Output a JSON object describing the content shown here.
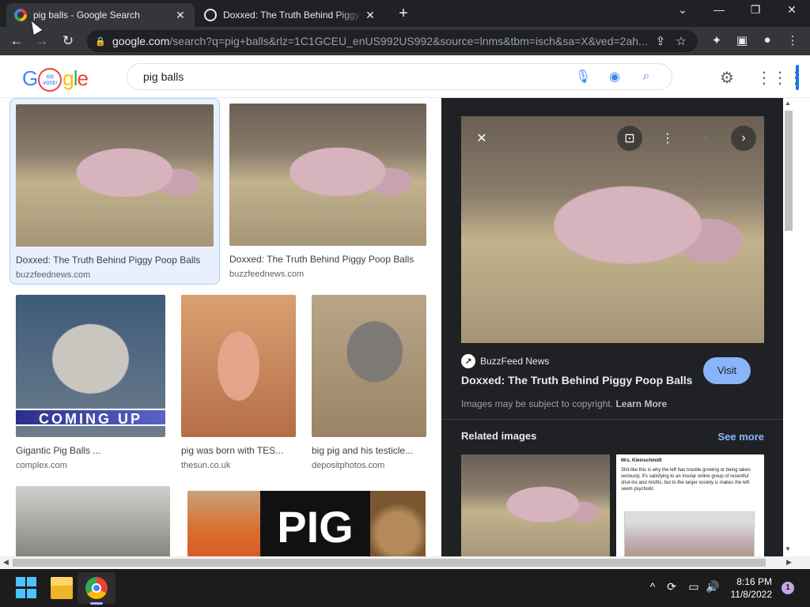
{
  "browser": {
    "tabs": [
      {
        "title": "pig balls - Google Search",
        "active": true
      },
      {
        "title": "Doxxed: The Truth Behind Piggy Poop Balls",
        "active": false
      }
    ],
    "new_tab": "+",
    "url_host": "google.com",
    "url_rest": "/search?q=pig+balls&rlz=1C1GCEU_enUS992US992&source=lnms&tbm=isch&sa=X&ved=2ah..."
  },
  "google": {
    "logo_letters": [
      "G",
      "o",
      "g",
      "l",
      "e"
    ],
    "doodle_text": "GO VOTE!",
    "query": "pig balls"
  },
  "results": [
    {
      "caption": "Doxxed: The Truth Behind Piggy Poop Balls",
      "source": "buzzfeednews.com",
      "selected": true
    },
    {
      "caption": "Doxxed: The Truth Behind Piggy Poop Balls",
      "source": "buzzfeednews.com"
    },
    {
      "caption": "Gigantic Pig Balls ...",
      "source": "complex.com",
      "overlay": "COMING UP"
    },
    {
      "caption": "pig was born with TES...",
      "source": "thesun.co.uk"
    },
    {
      "caption": "big pig and his testicle...",
      "source": "depositphotos.com"
    },
    {
      "caption": "",
      "source": ""
    },
    {
      "caption": "",
      "source": "",
      "overlay": "PIG"
    }
  ],
  "preview": {
    "source_name": "BuzzFeed News",
    "title": "Doxxed: The Truth Behind Piggy Poop Balls",
    "visit_label": "Visit",
    "copyright_text": "Images may be subject to copyright.",
    "learn_more": "Learn More",
    "related_heading": "Related images",
    "see_more": "See more",
    "related_tweet_author": "Mrs. Kleinschmidt",
    "related_tweet_text": "Shit like this is why the left has trouble growing or being taken seriously. It's satisfying to an insular online group of resentful shut-ins and misfits, but to the larger society is makes the left seem psychotic"
  },
  "taskbar": {
    "time": "8:16 PM",
    "date": "11/8/2022",
    "notification_count": "1"
  },
  "colors": {
    "accent": "#1a73e8",
    "panel_bg": "#202124",
    "visit_button": "#8ab4f8",
    "selected_card": "#e8f0fe"
  }
}
